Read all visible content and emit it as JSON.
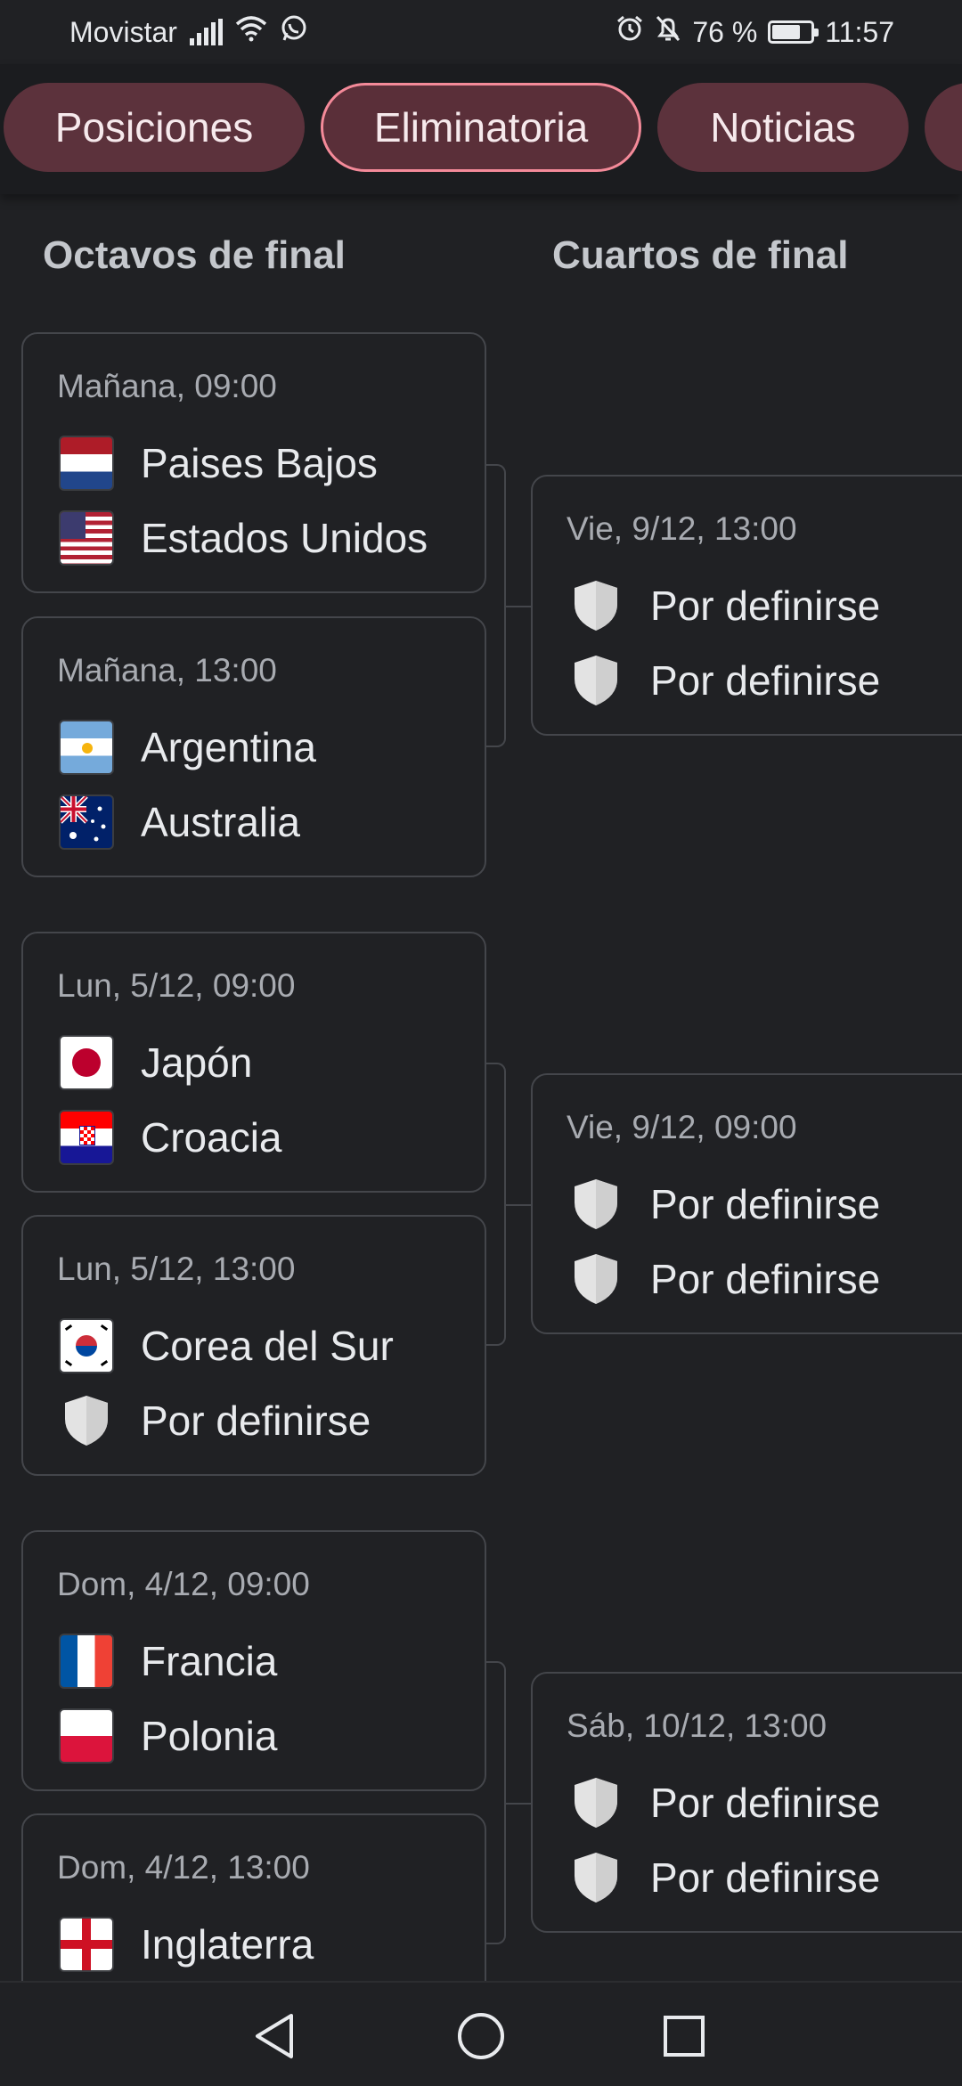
{
  "status_bar": {
    "carrier": "Movistar",
    "battery_percent": "76 %",
    "battery_level": 0.76,
    "time": "11:57"
  },
  "tabs": [
    {
      "label": "Posiciones",
      "active": false
    },
    {
      "label": "Eliminatoria",
      "active": true
    },
    {
      "label": "Noticias",
      "active": false
    }
  ],
  "columns": {
    "round_of_16": "Octavos de final",
    "quarterfinals": "Cuartos de final"
  },
  "round_of_16": [
    {
      "time": "Mañana, 09:00",
      "team1": "Paises Bajos",
      "team2": "Estados Unidos"
    },
    {
      "time": "Mañana, 13:00",
      "team1": "Argentina",
      "team2": "Australia"
    },
    {
      "time": "Lun, 5/12, 09:00",
      "team1": "Japón",
      "team2": "Croacia"
    },
    {
      "time": "Lun, 5/12, 13:00",
      "team1": "Corea del Sur",
      "team2": "Por definirse"
    },
    {
      "time": "Dom, 4/12, 09:00",
      "team1": "Francia",
      "team2": "Polonia"
    },
    {
      "time": "Dom, 4/12, 13:00",
      "team1": "Inglaterra",
      "team2": ""
    }
  ],
  "quarterfinals": [
    {
      "time": "Vie, 9/12, 13:00",
      "team1": "Por definirse",
      "team2": "Por definirse"
    },
    {
      "time": "Vie, 9/12, 09:00",
      "team1": "Por definirse",
      "team2": "Por definirse"
    },
    {
      "time": "Sáb, 10/12, 13:00",
      "team1": "Por definirse",
      "team2": "Por definirse"
    }
  ],
  "icons": {
    "signal": "signal-icon",
    "wifi": "wifi-icon",
    "whatsapp": "whatsapp-icon",
    "alarm": "alarm-icon",
    "bell_off": "bell-off-icon",
    "battery": "battery-icon",
    "placeholder_team": "shield-icon",
    "nav_back": "back-triangle-icon",
    "nav_home": "home-circle-icon",
    "nav_recents": "recents-square-icon"
  },
  "colors": {
    "background": "#202124",
    "tab_bg": "#5c323c",
    "tab_active_border": "#f48a99",
    "card_border": "#44464b"
  }
}
